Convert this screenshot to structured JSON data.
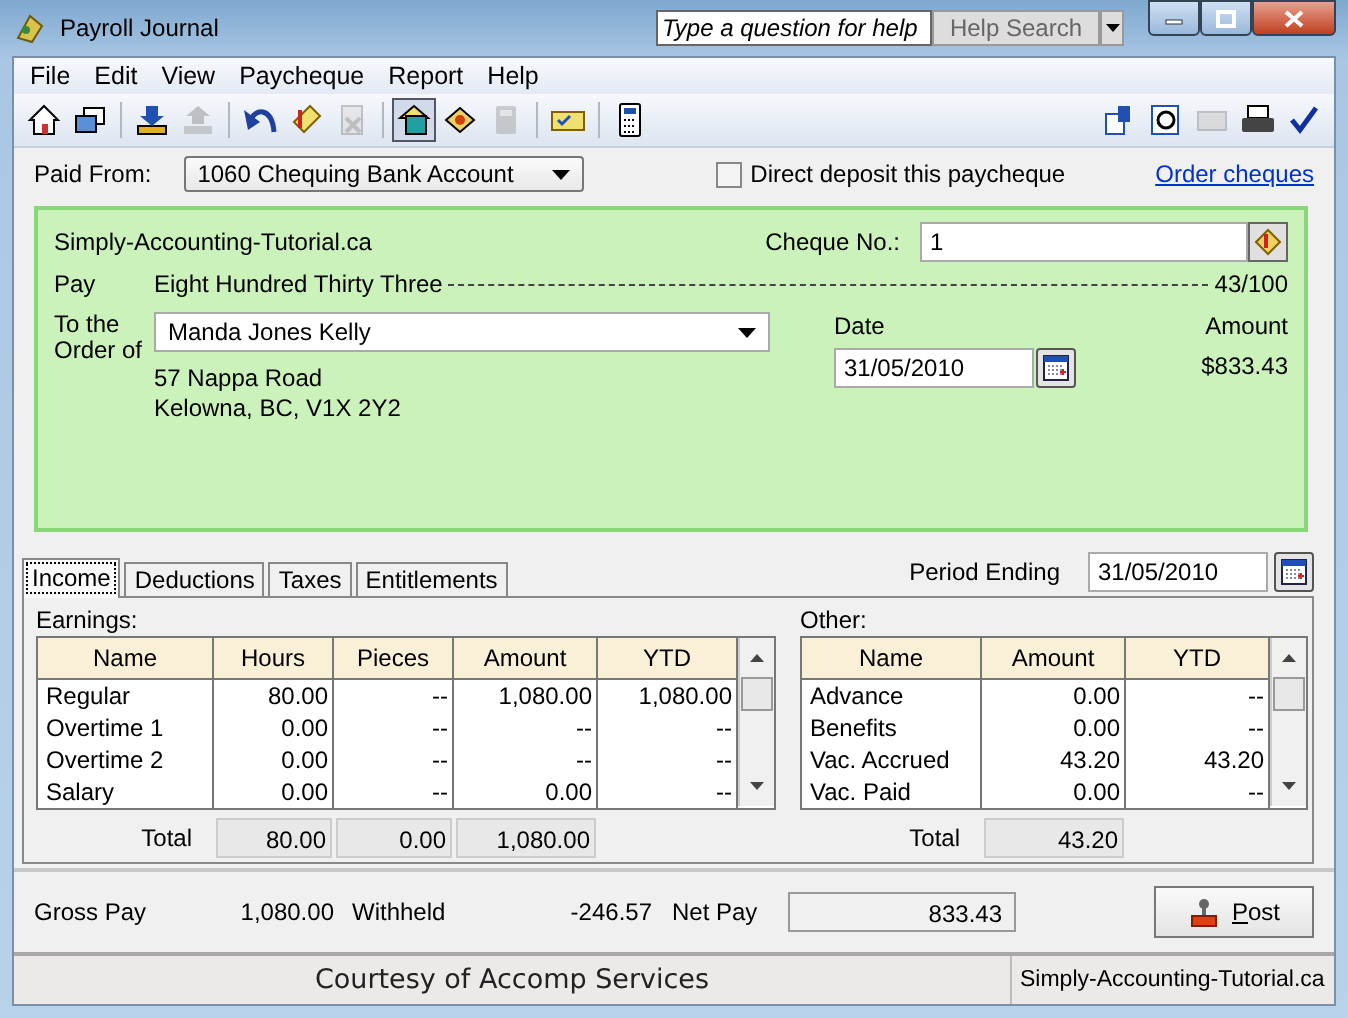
{
  "window": {
    "title": "Payroll Journal"
  },
  "help_search": {
    "placeholder": "Type a question for help",
    "button": "Help Search"
  },
  "menu": [
    "File",
    "Edit",
    "View",
    "Paycheque",
    "Report",
    "Help"
  ],
  "toolbar": {
    "left": [
      [
        {
          "kind": "home",
          "disabled": false,
          "pressed": false
        },
        {
          "kind": "windows",
          "disabled": false,
          "pressed": false
        }
      ],
      [
        {
          "kind": "import",
          "disabled": false,
          "pressed": false
        },
        {
          "kind": "export",
          "disabled": true,
          "pressed": false
        }
      ],
      [
        {
          "kind": "undo",
          "disabled": false,
          "pressed": false
        },
        {
          "kind": "recall",
          "disabled": false,
          "pressed": false
        },
        {
          "kind": "delete",
          "disabled": true,
          "pressed": false
        }
      ],
      [
        {
          "kind": "paycheque",
          "disabled": false,
          "pressed": true
        },
        {
          "kind": "cheque",
          "disabled": false,
          "pressed": false
        },
        {
          "kind": "calc",
          "disabled": true,
          "pressed": false
        }
      ],
      [
        {
          "kind": "card",
          "disabled": false,
          "pressed": false
        }
      ],
      [
        {
          "kind": "calculator",
          "disabled": false,
          "pressed": false
        }
      ]
    ],
    "right": [
      {
        "kind": "customize",
        "disabled": false
      },
      {
        "kind": "preview",
        "disabled": false
      },
      {
        "kind": "email",
        "disabled": true
      },
      {
        "kind": "print",
        "disabled": false
      },
      {
        "kind": "check",
        "disabled": false
      }
    ]
  },
  "paid_from": {
    "label": "Paid From:",
    "value": "1060 Chequing Bank Account"
  },
  "direct_deposit": {
    "label": "Direct deposit this paycheque",
    "checked": false
  },
  "order_link": "Order cheques",
  "cheque": {
    "company": "Simply-Accounting-Tutorial.ca",
    "cheque_no_label": "Cheque No.:",
    "cheque_no": "1",
    "pay_label": "Pay",
    "amount_words": "Eight Hundred Thirty Three",
    "cents": "43/100",
    "order_label": "To the Order of",
    "payee": "Manda Jones Kelly",
    "address": [
      "57 Nappa Road",
      "Kelowna, BC, V1X 2Y2"
    ],
    "date_label": "Date",
    "date": "31/05/2010",
    "amount_label": "Amount",
    "amount": "$833.43"
  },
  "tabs": [
    {
      "label": "Income",
      "selected": true
    },
    {
      "label": "Deductions",
      "selected": false
    },
    {
      "label": "Taxes",
      "selected": false
    },
    {
      "label": "Entitlements",
      "selected": false
    }
  ],
  "period_ending": {
    "label": "Period Ending",
    "value": "31/05/2010"
  },
  "earnings": {
    "title": "Earnings:",
    "columns": [
      "Name",
      "Hours",
      "Pieces",
      "Amount",
      "YTD"
    ],
    "rows": [
      [
        "Regular",
        "80.00",
        "--",
        "1,080.00",
        "1,080.00"
      ],
      [
        "Overtime 1",
        "0.00",
        "--",
        "--",
        "--"
      ],
      [
        "Overtime 2",
        "0.00",
        "--",
        "--",
        "--"
      ],
      [
        "Salary",
        "0.00",
        "--",
        "0.00",
        "--"
      ]
    ],
    "total_label": "Total",
    "totals": [
      "80.00",
      "0.00",
      "1,080.00"
    ]
  },
  "other": {
    "title": "Other:",
    "columns": [
      "Name",
      "Amount",
      "YTD"
    ],
    "rows": [
      [
        "Advance",
        "0.00",
        "--"
      ],
      [
        "Benefits",
        "0.00",
        "--"
      ],
      [
        "Vac. Accrued",
        "43.20",
        "43.20"
      ],
      [
        "Vac. Paid",
        "0.00",
        "--"
      ]
    ],
    "total_label": "Total",
    "totals": [
      "43.20"
    ]
  },
  "summary": {
    "gross_label": "Gross Pay",
    "gross": "1,080.00",
    "withheld_label": "Withheld",
    "withheld": "-246.57",
    "net_label": "Net Pay",
    "net": "833.43"
  },
  "post_button": "Post",
  "status_bar": {
    "center": "Courtesy of Accomp Services",
    "right": "Simply-Accounting-Tutorial.ca"
  }
}
